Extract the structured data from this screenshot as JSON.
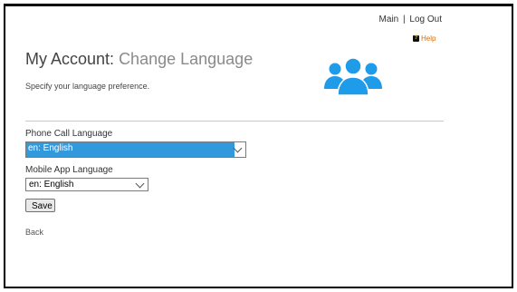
{
  "header": {
    "nav": {
      "main": "Main",
      "separator": "|",
      "logout": "Log Out"
    },
    "help": "Help"
  },
  "page": {
    "title": "My Account:",
    "subtitle": "Change Language",
    "description": "Specify your language preference."
  },
  "form": {
    "phone_language_label": "Phone Call Language",
    "phone_language_value": "en: English",
    "mobile_language_label": "Mobile App Language",
    "mobile_language_value": "en: English",
    "save_label": "Save",
    "back_label": "Back"
  },
  "colors": {
    "selected_highlight": "#3399dd",
    "icon_blue": "#1e9be9",
    "help_orange": "#e06a00"
  },
  "icons": {
    "header_image": "people-group-icon",
    "help": "help-icon"
  }
}
